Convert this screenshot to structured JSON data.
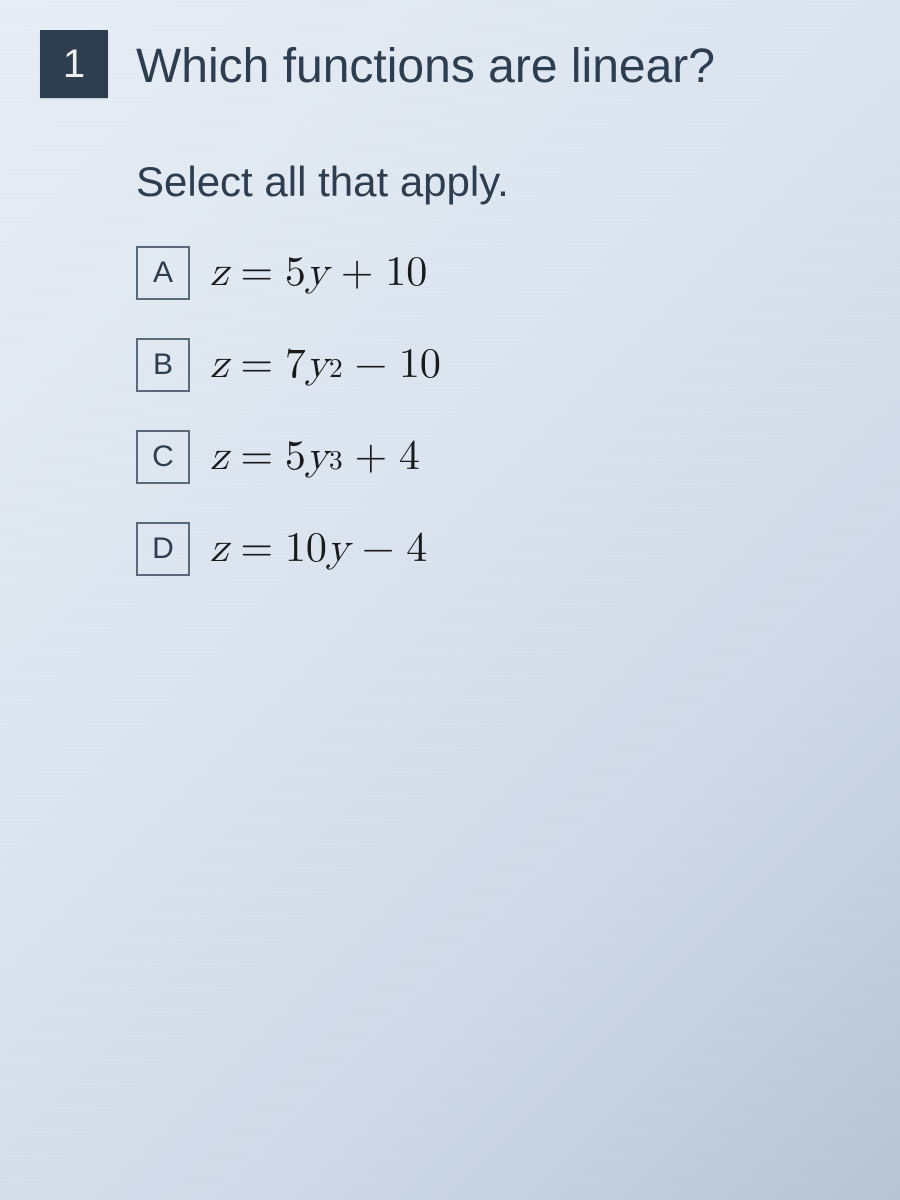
{
  "question": {
    "number": "1",
    "text": "Which functions are linear?",
    "instruction": "Select all that apply."
  },
  "options": [
    {
      "letter": "A",
      "lhs_var": "z",
      "coef": "5",
      "rhs_var": "y",
      "exp": "",
      "op": "+",
      "const": "10"
    },
    {
      "letter": "B",
      "lhs_var": "z",
      "coef": "7",
      "rhs_var": "y",
      "exp": "2",
      "op": "−",
      "const": "10"
    },
    {
      "letter": "C",
      "lhs_var": "z",
      "coef": "5",
      "rhs_var": "y",
      "exp": "3",
      "op": "+",
      "const": "4"
    },
    {
      "letter": "D",
      "lhs_var": "z",
      "coef": "10",
      "rhs_var": "y",
      "exp": "",
      "op": "−",
      "const": "4"
    }
  ]
}
